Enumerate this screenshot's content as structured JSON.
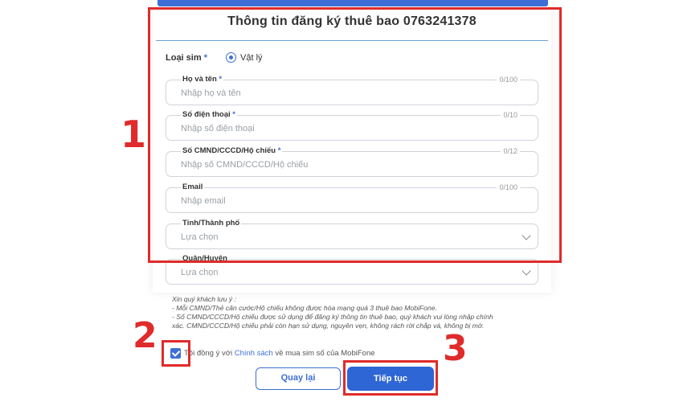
{
  "form": {
    "title": "Thông tin đăng ký thuê bao 0763241378",
    "sim_type": {
      "label": "Loại sim",
      "required_mark": "*",
      "option": "Vật lý"
    },
    "fields": [
      {
        "label": "Họ và tên",
        "required_mark": "*",
        "count": "0/100",
        "placeholder": "Nhập họ và tên"
      },
      {
        "label": "Số điện thoại",
        "required_mark": "*",
        "count": "0/10",
        "placeholder": "Nhập số điện thoại"
      },
      {
        "label": "Số CMND/CCCD/Hộ chiếu",
        "required_mark": "*",
        "count": "0/12",
        "placeholder": "Nhập số CMND/CCCD/Hộ chiếu"
      },
      {
        "label": "Email",
        "required_mark": "",
        "count": "0/100",
        "placeholder": "Nhập email"
      }
    ],
    "selects": [
      {
        "label": "Tỉnh/Thành phố",
        "value": "Lựa chọn"
      },
      {
        "label": "Quận/Huyện",
        "value": "Lựa chọn"
      }
    ]
  },
  "notes": {
    "heading": "Xin quý khách lưu ý :",
    "line1": "- Mỗi CMND/Thẻ căn cước/Hộ chiếu không được hòa mạng quá 3 thuê bao MobiFone.",
    "line2": "- Số CMND/CCCD/Hộ chiếu được sử dụng để đăng ký thông tin thuê bao, quý khách vui lòng nhập chính",
    "line3": "xác. CMND/CCCD/Hộ chiếu phải còn hạn sử dụng, nguyên vẹn, không rách rời chắp vá, không bị mờ."
  },
  "agreement": {
    "prefix": "Tôi đồng ý với ",
    "link": "Chính sách",
    "suffix": " về mua sim số của MobiFone",
    "checked": true
  },
  "buttons": {
    "back": "Quay lại",
    "next": "Tiếp tục"
  },
  "annotations": {
    "step1": "1",
    "step2": "2",
    "step3": "3"
  },
  "colors": {
    "accent": "#3d6fd6",
    "annotation": "#e02b2b"
  }
}
